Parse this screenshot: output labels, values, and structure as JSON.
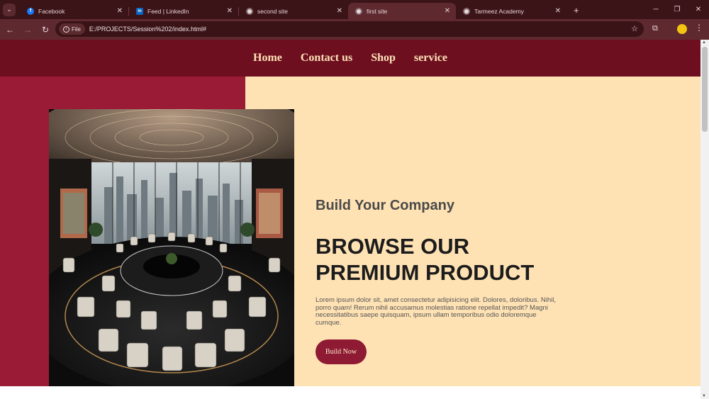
{
  "browser": {
    "tabs": [
      {
        "title": "Facebook",
        "icon": "facebook-icon",
        "color": "#1877f2",
        "glyph": "f"
      },
      {
        "title": "Feed | LinkedIn",
        "icon": "linkedin-icon",
        "color": "#0a66c2",
        "glyph": "in"
      },
      {
        "title": "second site",
        "icon": "globe-icon",
        "color": "#8a6a6e",
        "glyph": "◍"
      },
      {
        "title": "first site",
        "icon": "globe-icon",
        "color": "#8a6a6e",
        "glyph": "◍",
        "active": true
      },
      {
        "title": "Tarmeez Academy",
        "icon": "globe-icon",
        "color": "#8a6a6e",
        "glyph": "◍"
      }
    ],
    "address": {
      "scheme_label": "File",
      "url": "E:/PROJECTS/Session%202/index.html#"
    }
  },
  "site": {
    "nav": [
      "Home",
      "Contact us",
      "Shop",
      "service"
    ],
    "hero": {
      "subtitle": "Build Your Company",
      "headline_line1": "BROWSE OUR",
      "headline_line2": "PREMIUM PRODUCT",
      "body": "Lorem ipsum dolor sit, amet consectetur adipisicing elit. Dolores, doloribus. Nihil, porro quam! Rerum nihil accusamus molestias ratione repellat impedit? Magni necessitatibus saepe quisquam, ipsum ullam temporibus odio doloremque cumque.",
      "cta_label": "Build Now"
    },
    "colors": {
      "nav_bg": "#6e0f1f",
      "left_block": "#9a1b36",
      "right_block": "#ffe2b4",
      "cta_bg": "#8e1a34"
    }
  }
}
